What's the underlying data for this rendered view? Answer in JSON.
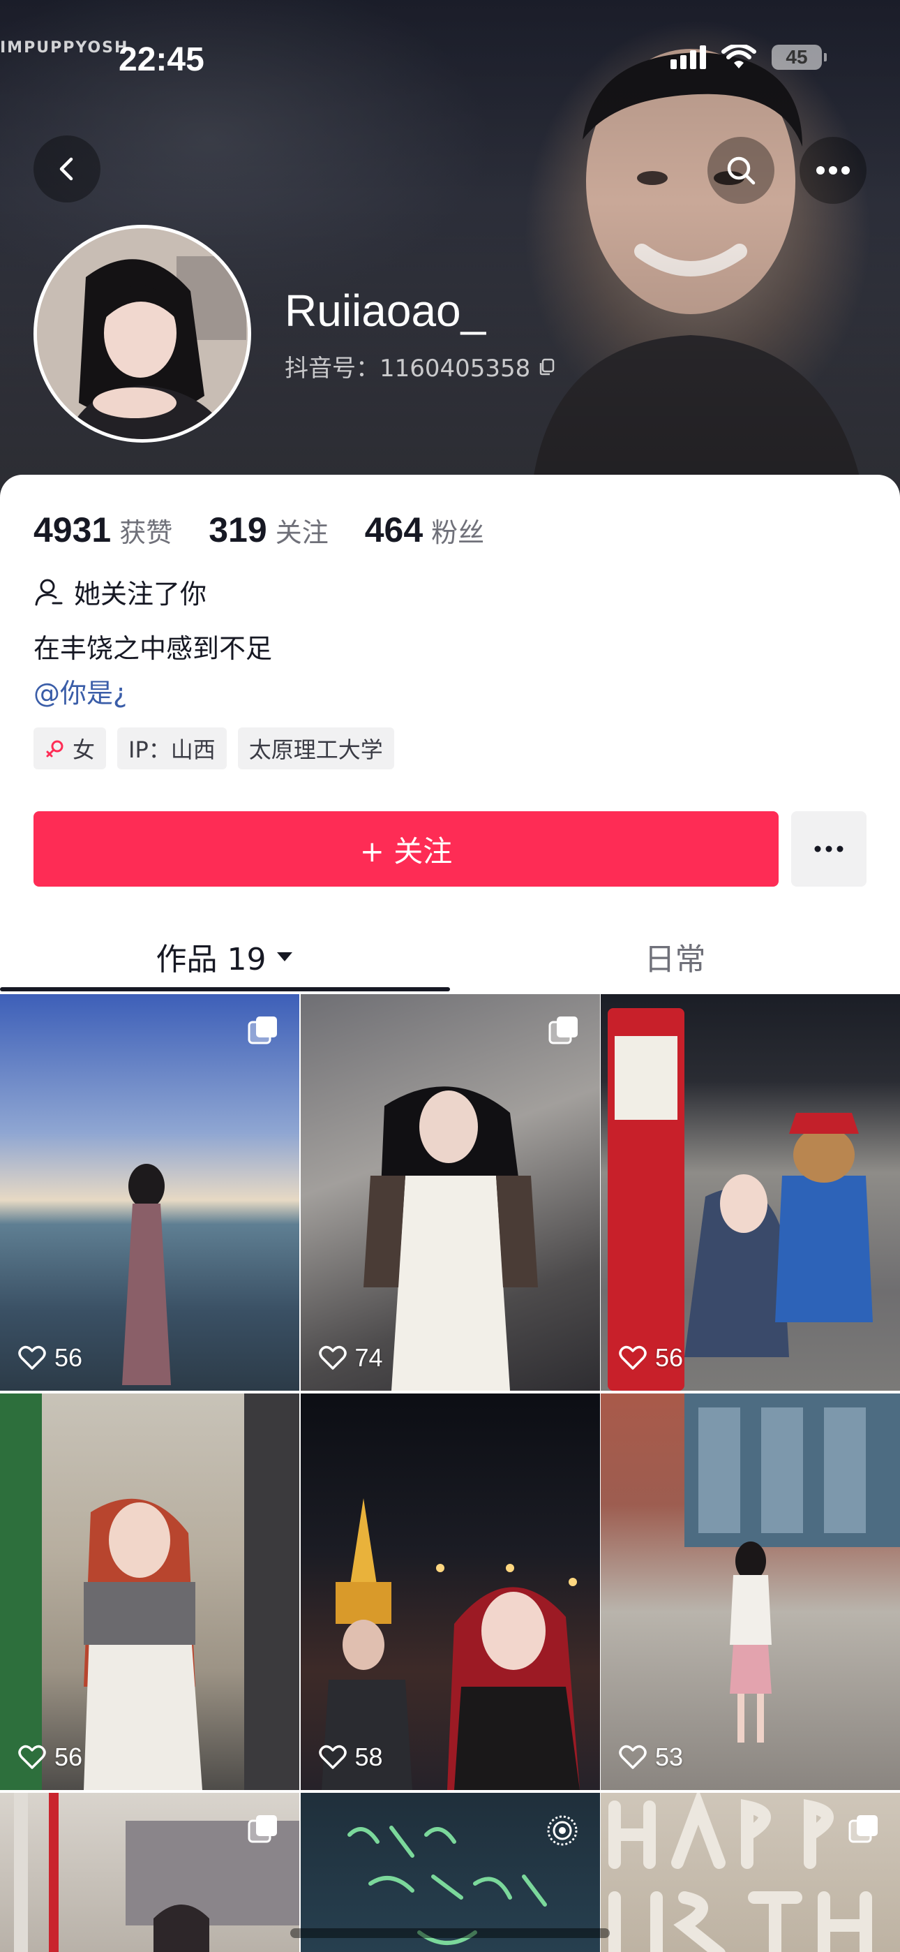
{
  "status_bar": {
    "time": "22:45",
    "battery": "45",
    "watermark": "IMPUPPYOSH"
  },
  "profile": {
    "username": "Ruiiaoao_",
    "douyin_id": "抖音号：1160405358",
    "stats": [
      {
        "value": "4931",
        "label": "获赞"
      },
      {
        "value": "319",
        "label": "关注"
      },
      {
        "value": "464",
        "label": "粉丝"
      }
    ],
    "follow_status": "她关注了你",
    "bio": "在丰饶之中感到不足",
    "mention": "@你是¿",
    "tags": {
      "gender": "女",
      "ip": "IP：山西",
      "school": "太原理工大学"
    }
  },
  "actions": {
    "follow_label": "+ 关注"
  },
  "tabs": {
    "works": "作品 19",
    "daily": "日常"
  },
  "posts": [
    {
      "likes": "56",
      "multi": true
    },
    {
      "likes": "74",
      "multi": true
    },
    {
      "likes": "56",
      "multi": false
    },
    {
      "likes": "56",
      "multi": false
    },
    {
      "likes": "58",
      "multi": false
    },
    {
      "likes": "53",
      "multi": false
    },
    {
      "likes": "",
      "multi": true
    },
    {
      "likes": "",
      "live": true,
      "overlay_text": "我今天很开心"
    },
    {
      "likes": "",
      "multi": true,
      "overlay_text": "HAPPY BIRTHDAY"
    }
  ],
  "colors": {
    "accent": "#fe2c55",
    "link": "#3a5da8",
    "gender_icon": "#fe2c55"
  }
}
